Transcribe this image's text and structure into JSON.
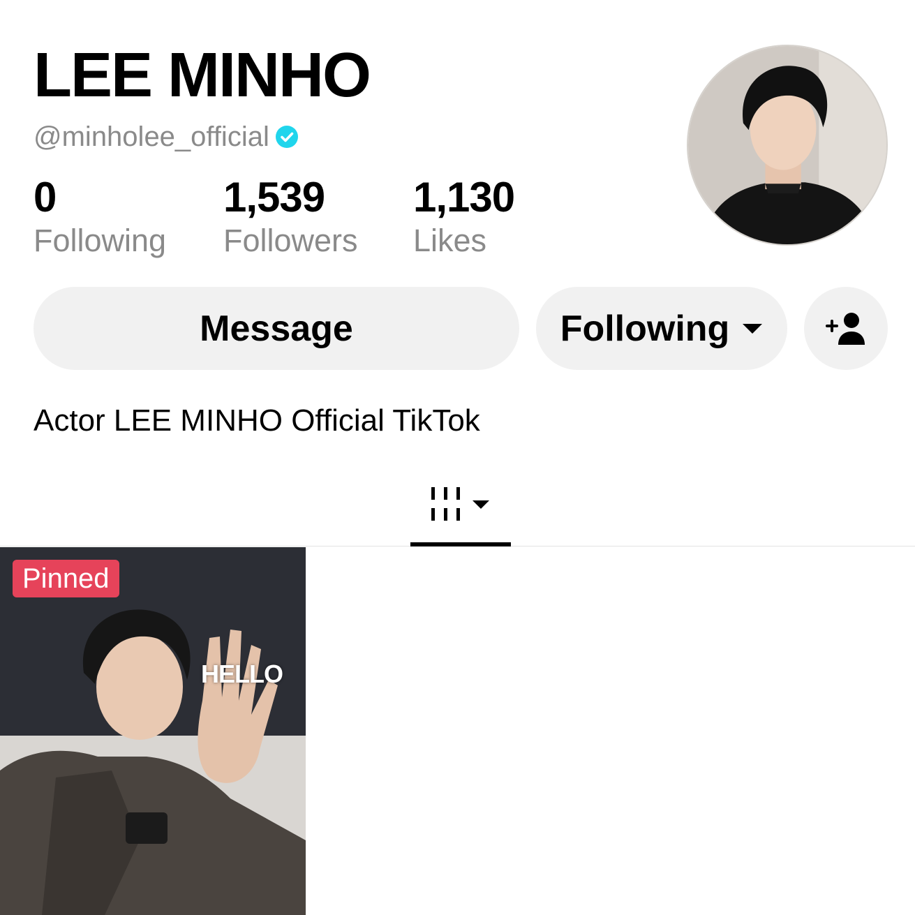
{
  "profile": {
    "display_name": "LEE MINHO",
    "handle": "@minholee_official",
    "verified": true,
    "bio": "Actor LEE MINHO Official TikTok"
  },
  "stats": {
    "following_count": "0",
    "following_label": "Following",
    "followers_count": "1,539",
    "followers_label": "Followers",
    "likes_count": "1,130",
    "likes_label": "Likes"
  },
  "actions": {
    "message_label": "Message",
    "following_label": "Following"
  },
  "tabs": {
    "videos_icon": "video-grid-icon"
  },
  "videos": [
    {
      "badge": "Pinned",
      "overlay_text": "HELLO"
    }
  ],
  "colors": {
    "verified_blue": "#20d5ec",
    "pinned_red": "#e6435a",
    "button_bg": "#f1f1f1",
    "secondary_text": "#8a8a8a"
  }
}
